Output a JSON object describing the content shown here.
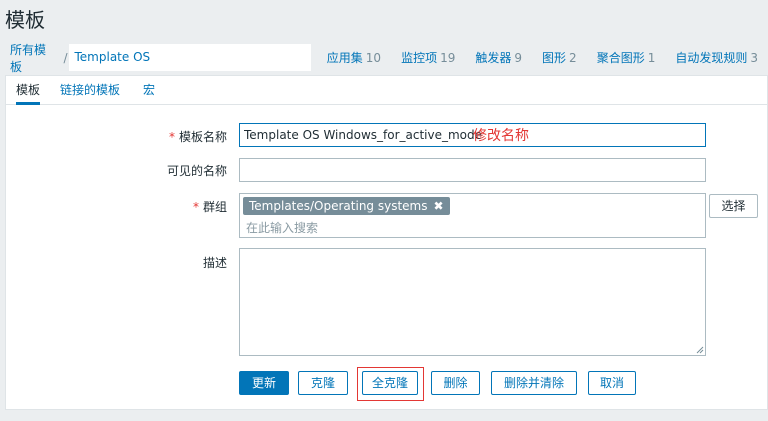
{
  "page": {
    "title": "模板"
  },
  "breadcrumb": {
    "all_templates": "所有模板",
    "separator": "/",
    "current": "Template OS Windows_for_active_mode"
  },
  "nav": [
    {
      "label": "应用集",
      "count": "10"
    },
    {
      "label": "监控项",
      "count": "19"
    },
    {
      "label": "触发器",
      "count": "9"
    },
    {
      "label": "图形",
      "count": "2"
    },
    {
      "label": "聚合图形",
      "count": "1"
    },
    {
      "label": "自动发现规则",
      "count": "3"
    }
  ],
  "tabs": [
    {
      "label": "模板",
      "active": true
    },
    {
      "label": "链接的模板",
      "active": false
    },
    {
      "label": "宏",
      "active": false
    }
  ],
  "form": {
    "required_mark": "*",
    "template_name_label": "模板名称",
    "template_name_value": "Template OS Windows_for_active_mode",
    "annotation": "修改名称",
    "visible_name_label": "可见的名称",
    "visible_name_value": "",
    "groups_label": "群组",
    "group_chip": "Templates/Operating systems",
    "groups_placeholder": "在此输入搜索",
    "select_button": "选择",
    "description_label": "描述",
    "description_value": ""
  },
  "buttons": {
    "update": "更新",
    "clone": "克隆",
    "full_clone": "全克隆",
    "delete": "删除",
    "delete_and_clear": "删除并清除",
    "cancel": "取消"
  },
  "colors": {
    "accent": "#0275b8",
    "required": "#e33734",
    "chip": "#768d99",
    "background": "#ebeef0"
  }
}
